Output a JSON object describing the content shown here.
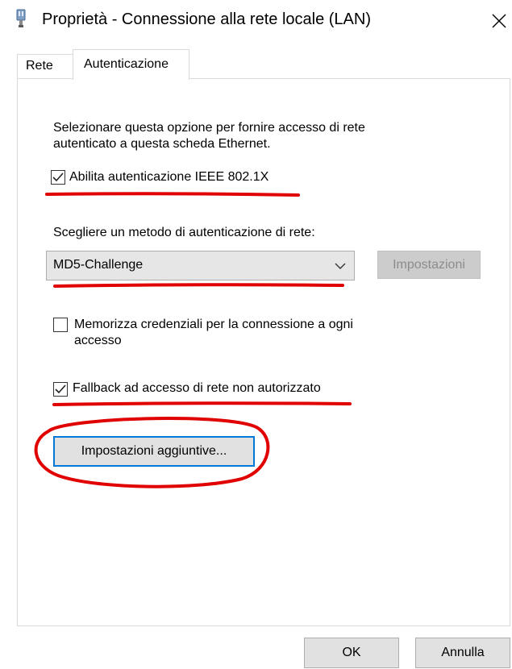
{
  "window": {
    "title": "Proprietà - Connessione alla rete locale (LAN)",
    "close_glyph": "✕"
  },
  "tabs": [
    {
      "label": "Rete",
      "active": false
    },
    {
      "label": "Autenticazione",
      "active": true
    }
  ],
  "auth": {
    "description_line1": "Selezionare questa opzione per fornire accesso di rete",
    "description_line2": "autenticato a questa scheda Ethernet.",
    "enable_8021x": {
      "label": "Abilita autenticazione IEEE 802.1X",
      "checked": true
    },
    "method_label": "Scegliere un metodo di autenticazione di rete:",
    "method_value": "MD5-Challenge",
    "settings_button": "Impostazioni",
    "remember_credentials": {
      "label_line1": "Memorizza credenziali per la connessione a ogni",
      "label_line2": "accesso",
      "checked": false
    },
    "fallback": {
      "label": "Fallback ad accesso di rete non autorizzato",
      "checked": true
    },
    "additional_settings_button": "Impostazioni aggiuntive..."
  },
  "footer": {
    "ok": "OK",
    "cancel": "Annulla"
  },
  "colors": {
    "annotation_red": "#e00000",
    "focus_blue": "#0078d7"
  }
}
